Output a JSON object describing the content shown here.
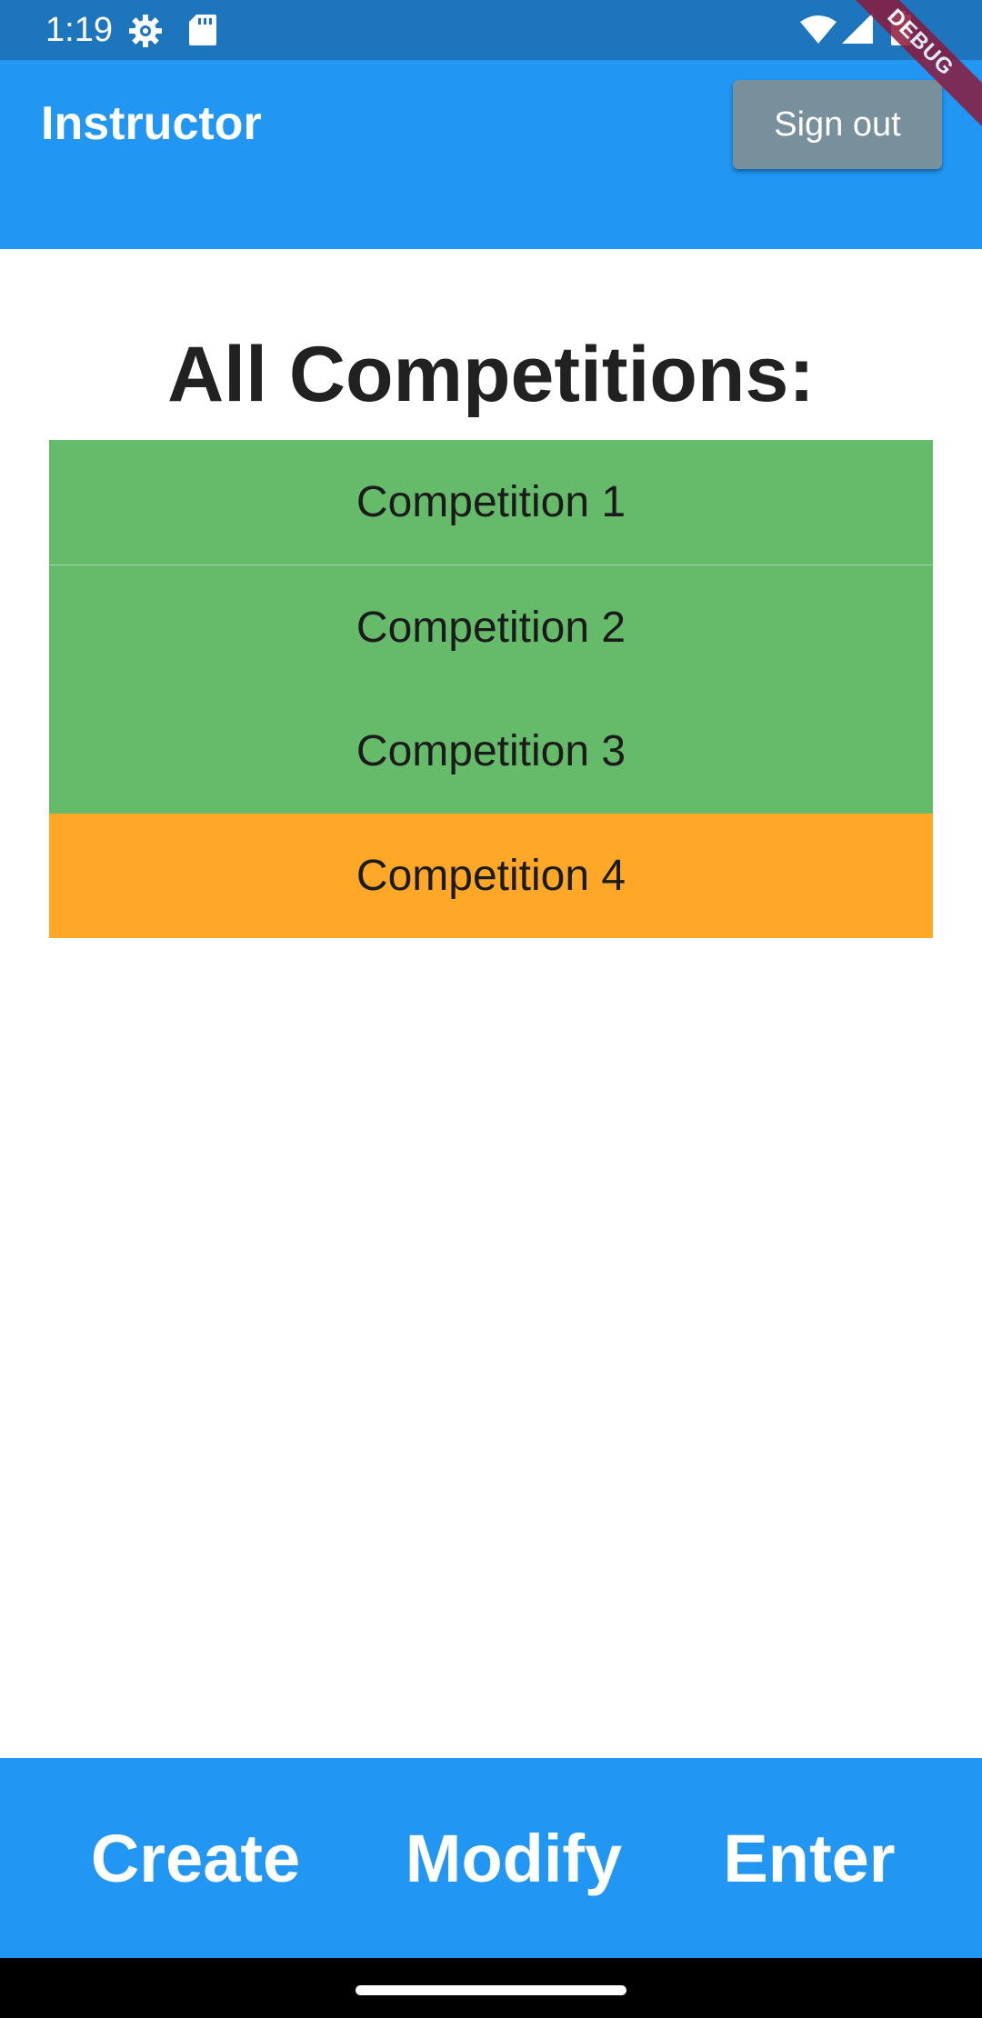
{
  "status_bar": {
    "time": "1:19",
    "icons": [
      "settings-gear-icon",
      "sd-card-icon",
      "wifi-icon",
      "cell-signal-icon",
      "battery-icon"
    ]
  },
  "app_bar": {
    "title": "Instructor",
    "sign_out_label": "Sign out",
    "background": "#2196f3"
  },
  "debug_banner": {
    "label": "DEBUG"
  },
  "main": {
    "heading": "All Competitions:",
    "competitions": [
      {
        "label": "Competition 1",
        "color": "#66bb6a"
      },
      {
        "label": "Competition 2",
        "color": "#66bb6a"
      },
      {
        "label": "Competition 3",
        "color": "#66bb6a"
      },
      {
        "label": "Competition 4",
        "color": "#ffa726"
      }
    ]
  },
  "bottom_bar": {
    "create_label": "Create",
    "modify_label": "Modify",
    "enter_label": "Enter"
  },
  "colors": {
    "status_bar": "#1c75bd",
    "app_bar": "#2196f3",
    "sign_out_button": "#78909c",
    "competition_green": "#66bb6a",
    "competition_orange": "#ffa726"
  }
}
